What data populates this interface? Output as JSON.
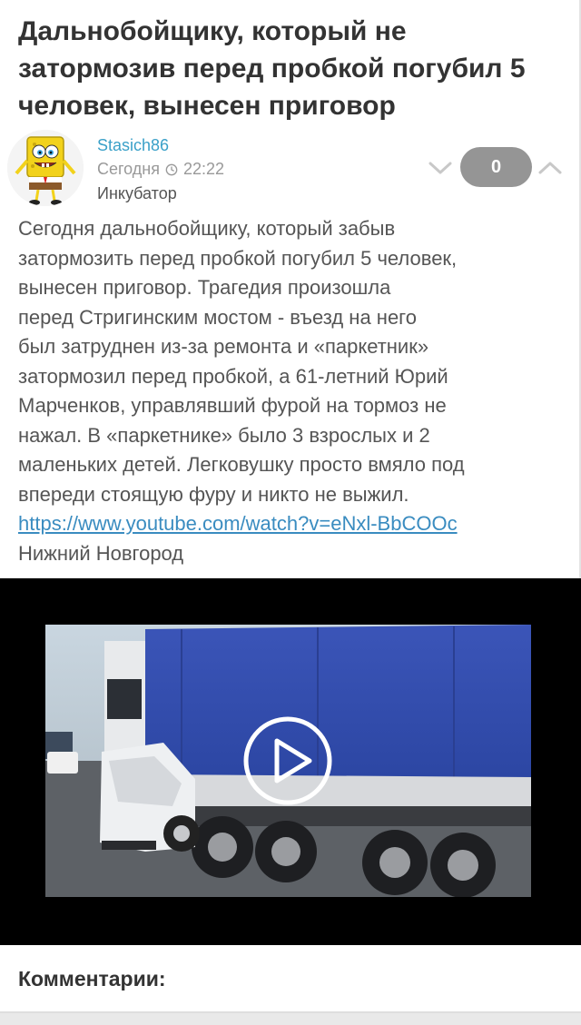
{
  "post": {
    "title": "Дальнобойщику, который не затормозив перед пробкой погубил 5 человек, вынесен приговор",
    "author": "Stasich86",
    "date": "Сегодня",
    "time": "22:22",
    "community": "Инкубатор",
    "rating": "0",
    "body_lines": [
      "Сегодня дальнобойщику, который забыв",
      "затормозить перед пробкой погубил 5 человек,",
      "вынесен приговор. Трагедия произошла",
      "перед Стригинским мостом - въезд на него",
      "был затруднен из-за ремонта и «паркетник»",
      "затормозил перед пробкой, а 61-летний Юрий",
      "Марченков, управлявший фурой на тормоз не",
      "нажал. В «паркетнике» было 3 взрослых и 2",
      "маленьких детей. Легковушку просто вмяло под",
      "впереди стоящую фуру и никто не выжил."
    ],
    "link": "https://www.youtube.com/watch?v=eNxl-BbCOOc",
    "location": "Нижний Новгород"
  },
  "icons": {
    "clock": "clock-icon",
    "vote_down": "chevron-down-icon",
    "vote_up": "chevron-up-icon",
    "play": "play-icon"
  },
  "comments": {
    "title": "Комментарии:"
  },
  "colors": {
    "author": "#3aa0c8",
    "rating_bg": "#959595",
    "link": "#3a8cc0",
    "title": "#333333",
    "text": "#555555"
  }
}
